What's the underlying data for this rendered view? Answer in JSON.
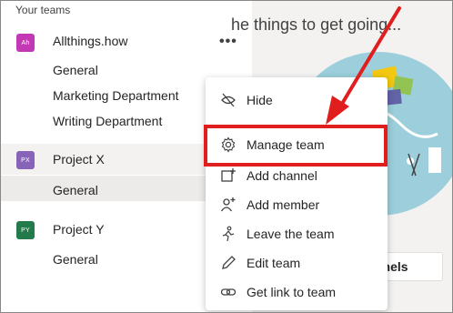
{
  "sidebar": {
    "section_title": "Your teams",
    "teams": [
      {
        "initials": "Ah",
        "name": "Allthings.how",
        "color": "#c239b3",
        "more_label": "•••",
        "channels": [
          "General",
          "Marketing Department",
          "Writing Department"
        ]
      },
      {
        "initials": "PX",
        "name": "Project X",
        "color": "#8764b8",
        "channels": [
          "General"
        ]
      },
      {
        "initials": "PY",
        "name": "Project Y",
        "color": "#237b4b",
        "channels": [
          "General"
        ]
      }
    ]
  },
  "main": {
    "banner_text": "he things to get going...",
    "channels_button": "nnels"
  },
  "context_menu": {
    "items": [
      {
        "label": "Hide",
        "icon": "hide-icon"
      },
      {
        "label": "Manage team",
        "icon": "gear-icon"
      },
      {
        "label": "Add channel",
        "icon": "add-channel-icon"
      },
      {
        "label": "Add member",
        "icon": "add-member-icon"
      },
      {
        "label": "Leave the team",
        "icon": "leave-icon"
      },
      {
        "label": "Edit team",
        "icon": "pencil-icon"
      },
      {
        "label": "Get link to team",
        "icon": "link-icon"
      }
    ]
  },
  "colors": {
    "highlight": "#e01e1e",
    "sidebar_bg": "#ffffff",
    "main_bg": "#f3f2f1"
  }
}
